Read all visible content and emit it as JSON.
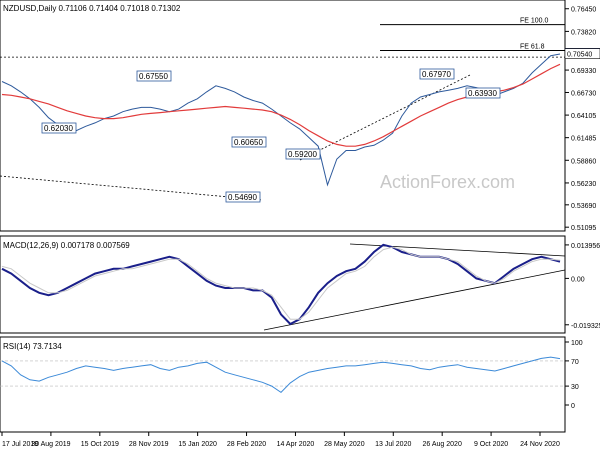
{
  "chart_data": {
    "type": "line",
    "symbol_header": "NZDUSD,Daily  0.71106 0.71404 0.71018 0.71302",
    "watermark": "ActionForex.com",
    "x_ticks": [
      "17 Jul 2019",
      "30 Aug 2019",
      "15 Oct 2019",
      "28 Nov 2019",
      "15 Jan 2020",
      "28 Feb 2020",
      "14 Apr 2020",
      "28 May 2020",
      "13 Jul 2020",
      "26 Aug 2020",
      "9 Oct 2020",
      "24 Nov 2020"
    ],
    "price_panel": {
      "ylim": [
        0.51,
        0.77
      ],
      "y_ticks": [
        "0.76450",
        "0.73820",
        "0.71302",
        "0.69330",
        "0.66730",
        "0.64105",
        "0.61485",
        "0.58860",
        "0.56230",
        "0.53690",
        "0.51095"
      ],
      "current_price": "0.71302",
      "second_price_tag": "0.70540",
      "fib_levels": [
        {
          "label": "FE 100.0",
          "value": 0.746
        },
        {
          "label": "FE 61.8",
          "value": 0.716
        }
      ],
      "annotations": [
        "0.67550",
        "0.62030",
        "0.60650",
        "0.59200",
        "0.54690",
        "0.67970",
        "0.63930"
      ],
      "series": [
        {
          "name": "NZDUSD",
          "color": "#2e5a9c",
          "values": [
            0.68,
            0.675,
            0.668,
            0.66,
            0.65,
            0.638,
            0.63,
            0.625,
            0.623,
            0.628,
            0.632,
            0.637,
            0.64,
            0.645,
            0.648,
            0.65,
            0.65,
            0.648,
            0.645,
            0.648,
            0.655,
            0.66,
            0.668,
            0.675,
            0.672,
            0.668,
            0.662,
            0.658,
            0.655,
            0.648,
            0.64,
            0.632,
            0.625,
            0.615,
            0.605,
            0.56,
            0.59,
            0.6,
            0.6,
            0.604,
            0.606,
            0.612,
            0.62,
            0.64,
            0.655,
            0.662,
            0.665,
            0.668,
            0.67,
            0.672,
            0.675,
            0.673,
            0.67,
            0.664,
            0.668,
            0.672,
            0.678,
            0.69,
            0.7,
            0.71,
            0.712
          ]
        },
        {
          "name": "MA",
          "color": "#e23b3b",
          "values": [
            0.665,
            0.664,
            0.662,
            0.66,
            0.657,
            0.654,
            0.65,
            0.646,
            0.643,
            0.64,
            0.638,
            0.637,
            0.637,
            0.638,
            0.64,
            0.642,
            0.643,
            0.644,
            0.645,
            0.646,
            0.647,
            0.648,
            0.649,
            0.65,
            0.651,
            0.65,
            0.649,
            0.648,
            0.647,
            0.645,
            0.641,
            0.636,
            0.63,
            0.623,
            0.617,
            0.611,
            0.607,
            0.605,
            0.605,
            0.607,
            0.611,
            0.616,
            0.622,
            0.628,
            0.634,
            0.64,
            0.645,
            0.65,
            0.655,
            0.659,
            0.662,
            0.665,
            0.667,
            0.668,
            0.67,
            0.673,
            0.677,
            0.683,
            0.689,
            0.695,
            0.7
          ]
        }
      ]
    },
    "macd_panel": {
      "label": "MACD(12,26,9) 0.007178 0.007569",
      "ylim": [
        -0.0215,
        0.016
      ],
      "y_ticks": [
        "0.013956",
        "0.00",
        "-0.019325"
      ],
      "series": [
        {
          "name": "MACD",
          "color": "#1a1f8a",
          "values": [
            0.004,
            0.002,
            -0.001,
            -0.004,
            -0.006,
            -0.007,
            -0.006,
            -0.004,
            -0.002,
            0.0,
            0.002,
            0.003,
            0.004,
            0.004,
            0.005,
            0.006,
            0.007,
            0.008,
            0.009,
            0.008,
            0.005,
            0.002,
            -0.001,
            -0.003,
            -0.004,
            -0.004,
            -0.004,
            -0.005,
            -0.005,
            -0.008,
            -0.015,
            -0.019,
            -0.017,
            -0.012,
            -0.006,
            -0.002,
            0.001,
            0.003,
            0.004,
            0.007,
            0.011,
            0.014,
            0.013,
            0.011,
            0.01,
            0.009,
            0.009,
            0.009,
            0.008,
            0.006,
            0.003,
            0.0,
            -0.001,
            -0.002,
            0.001,
            0.004,
            0.006,
            0.008,
            0.009,
            0.008,
            0.007
          ]
        },
        {
          "name": "Signal",
          "color": "#c8c8c8",
          "values": [
            0.005,
            0.004,
            0.001,
            -0.002,
            -0.004,
            -0.006,
            -0.006,
            -0.005,
            -0.003,
            -0.001,
            0.001,
            0.002,
            0.003,
            0.004,
            0.004,
            0.005,
            0.006,
            0.007,
            0.008,
            0.008,
            0.006,
            0.003,
            0.0,
            -0.002,
            -0.003,
            -0.004,
            -0.004,
            -0.004,
            -0.005,
            -0.007,
            -0.012,
            -0.017,
            -0.017,
            -0.014,
            -0.009,
            -0.004,
            -0.001,
            0.002,
            0.003,
            0.005,
            0.009,
            0.012,
            0.013,
            0.012,
            0.01,
            0.009,
            0.009,
            0.009,
            0.008,
            0.007,
            0.004,
            0.001,
            -0.001,
            -0.002,
            0.0,
            0.003,
            0.005,
            0.007,
            0.008,
            0.008,
            0.0076
          ]
        }
      ]
    },
    "rsi_panel": {
      "label": "RSI(14) 73.7134",
      "ylim": [
        0,
        100
      ],
      "y_ticks": [
        "100",
        "70",
        "30",
        "0"
      ],
      "series": [
        {
          "name": "RSI",
          "color": "#3c8ad8",
          "values": [
            70,
            62,
            48,
            40,
            38,
            44,
            48,
            52,
            58,
            62,
            60,
            58,
            55,
            58,
            60,
            62,
            64,
            58,
            55,
            60,
            62,
            66,
            68,
            60,
            52,
            48,
            44,
            40,
            36,
            30,
            20,
            35,
            45,
            52,
            55,
            58,
            60,
            62,
            62,
            64,
            66,
            68,
            66,
            64,
            62,
            58,
            56,
            60,
            62,
            64,
            60,
            58,
            56,
            54,
            58,
            62,
            66,
            70,
            74,
            76,
            73.7
          ]
        }
      ]
    }
  }
}
